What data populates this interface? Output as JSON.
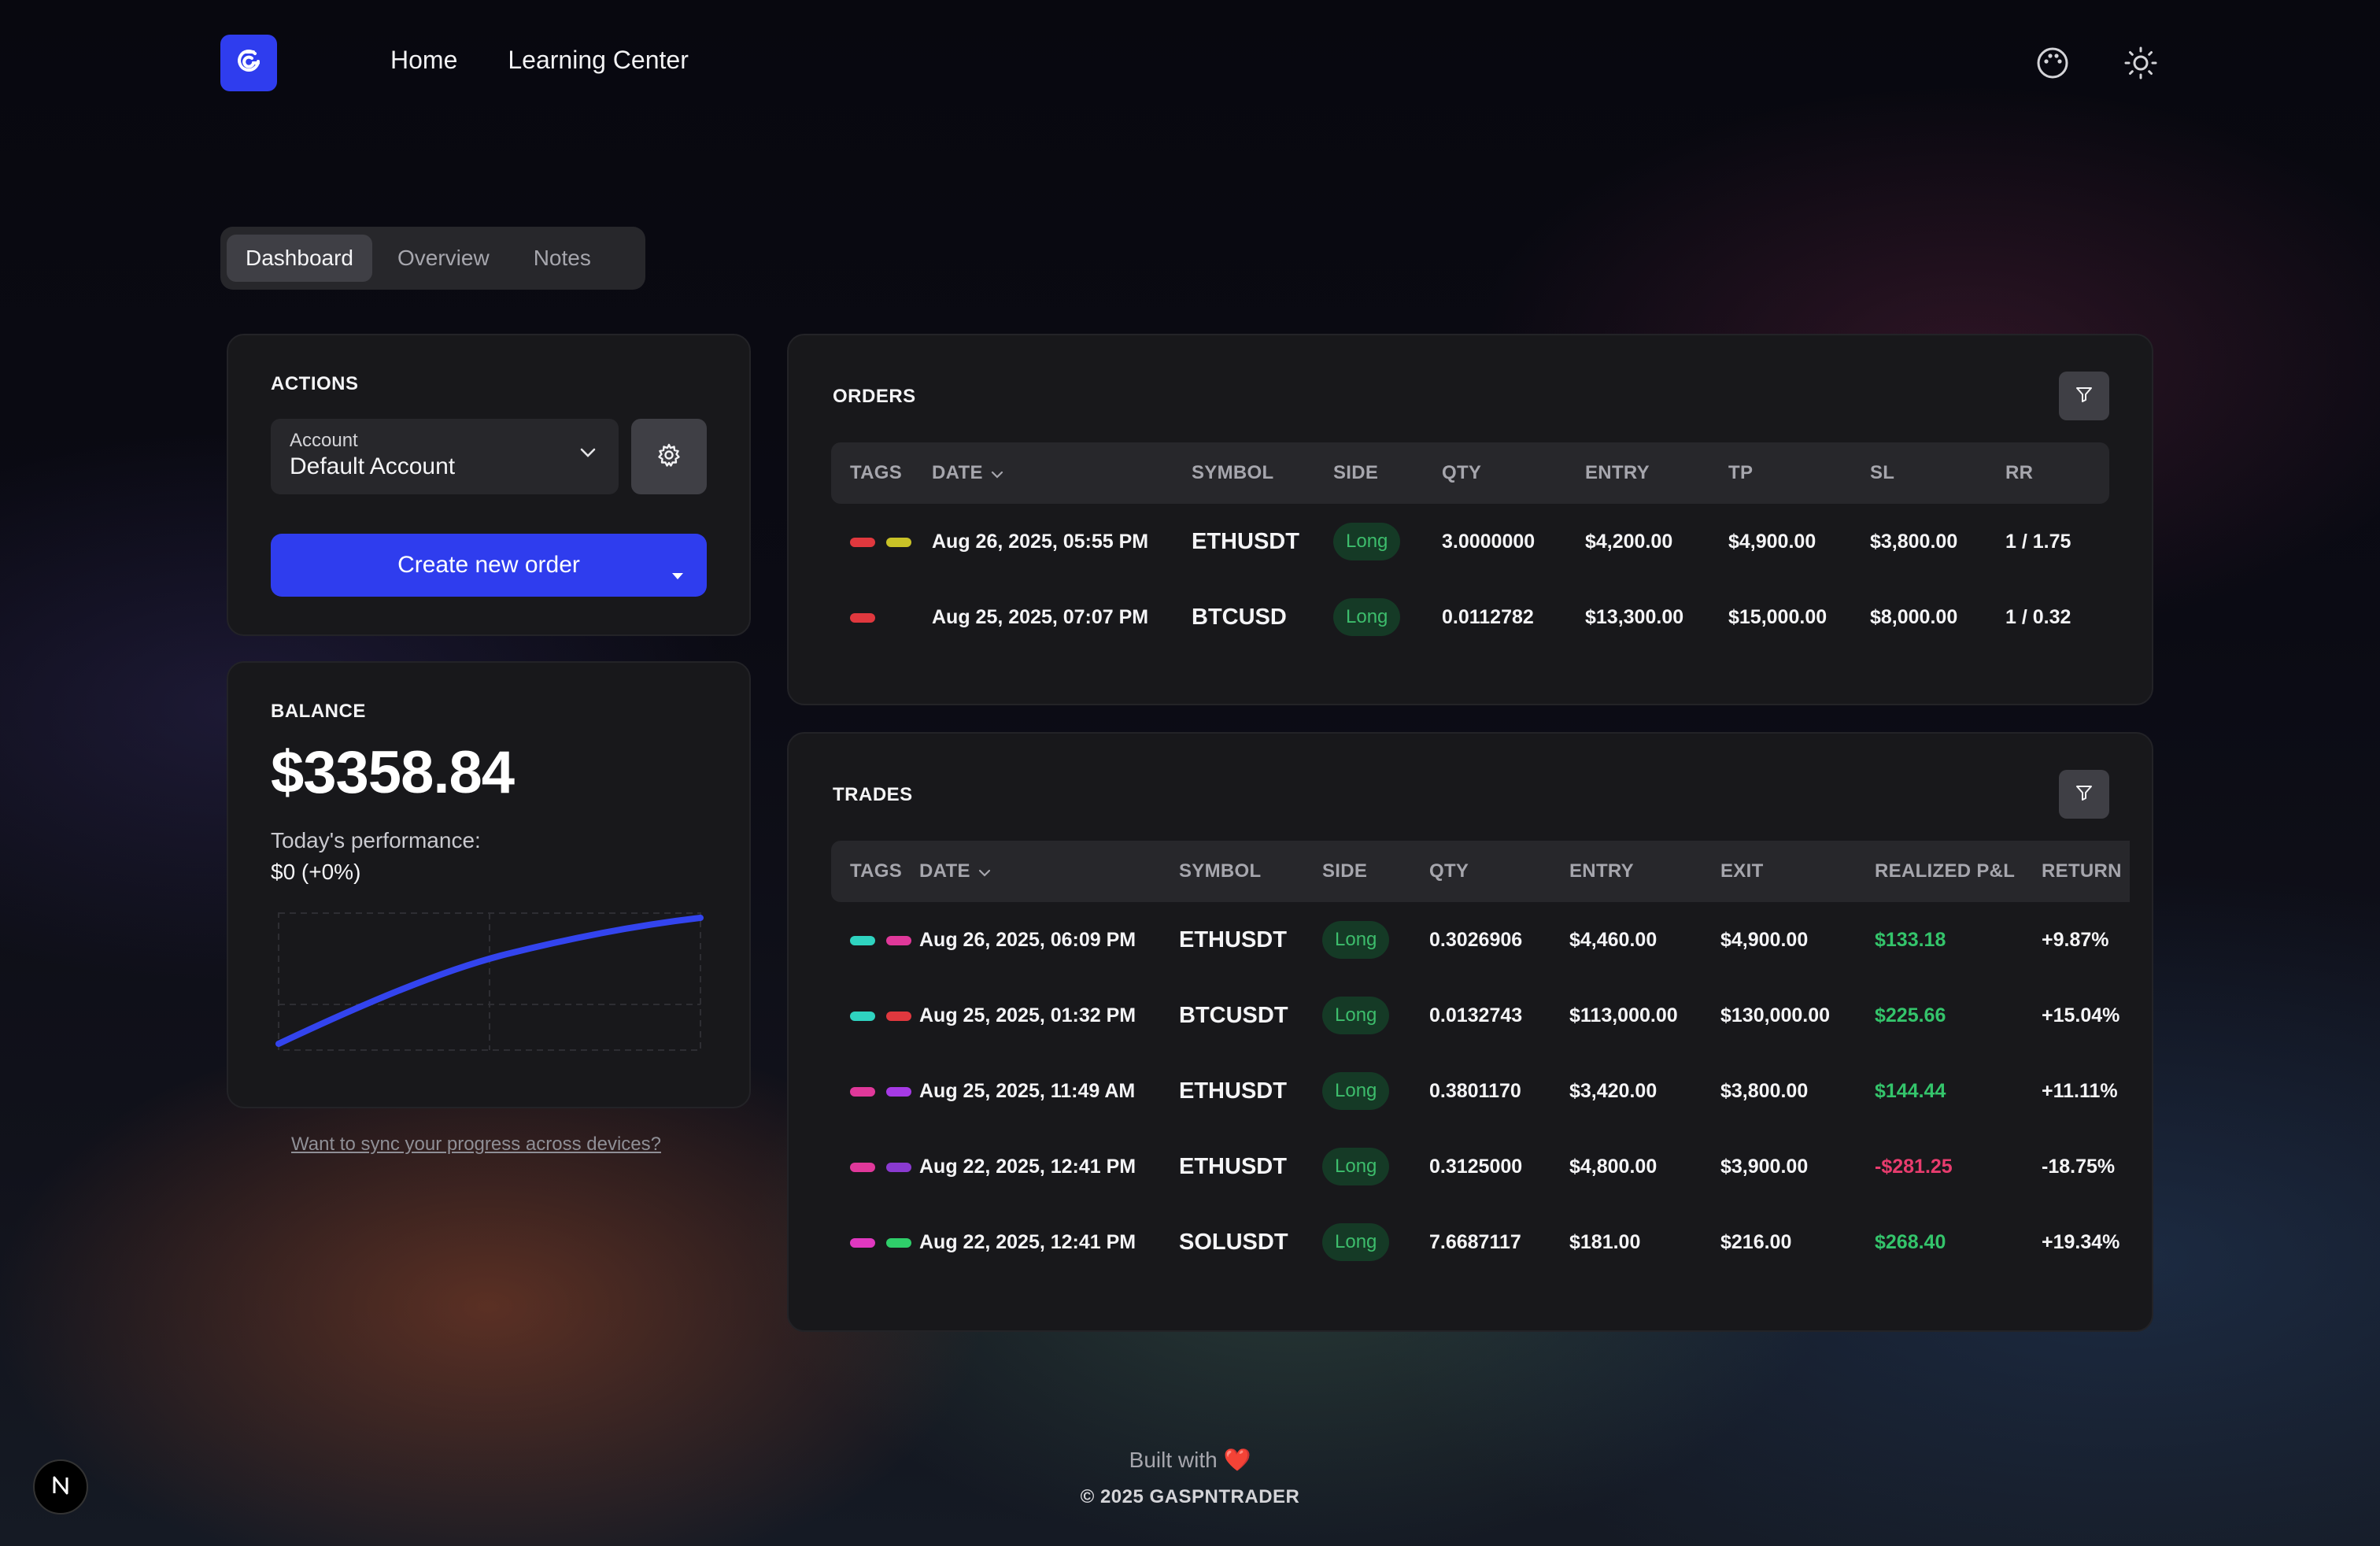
{
  "header": {
    "logo_icon": "swirl-logo-icon",
    "nav": [
      {
        "label": "Home"
      },
      {
        "label": "Learning Center"
      }
    ],
    "icons": [
      "palette-icon",
      "sun-icon"
    ]
  },
  "tabs": [
    {
      "label": "Dashboard",
      "active": true
    },
    {
      "label": "Overview",
      "active": false
    },
    {
      "label": "Notes",
      "active": false
    }
  ],
  "actions": {
    "title": "ACTIONS",
    "account_label": "Account",
    "account_value": "Default Account",
    "create_label": "Create new order"
  },
  "balance": {
    "title": "BALANCE",
    "amount": "$3358.84",
    "perf_label": "Today's performance:",
    "perf_value": "$0 (+0%)",
    "sparkline_trend": "rising"
  },
  "sync_link": "Want to sync your progress across devices?",
  "orders": {
    "title": "ORDERS",
    "columns": [
      "TAGS",
      "DATE",
      "SYMBOL",
      "SIDE",
      "QTY",
      "ENTRY",
      "TP",
      "SL",
      "RR"
    ],
    "rows": [
      {
        "tags": [
          "#e0383e",
          "#c9c227"
        ],
        "date": "Aug 26, 2025, 05:55 PM",
        "symbol": "ETHUSDT",
        "side": "Long",
        "qty": "3.0000000",
        "entry": "$4,200.00",
        "tp": "$4,900.00",
        "sl": "$3,800.00",
        "rr": "1 / 1.75"
      },
      {
        "tags": [
          "#e0383e"
        ],
        "date": "Aug 25, 2025, 07:07 PM",
        "symbol": "BTCUSD",
        "side": "Long",
        "qty": "0.0112782",
        "entry": "$13,300.00",
        "tp": "$15,000.00",
        "sl": "$8,000.00",
        "rr": "1 / 0.32"
      }
    ]
  },
  "trades": {
    "title": "TRADES",
    "columns": [
      "TAGS",
      "DATE",
      "SYMBOL",
      "SIDE",
      "QTY",
      "ENTRY",
      "EXIT",
      "REALIZED P&L",
      "RETURN"
    ],
    "rows": [
      {
        "tags": [
          "#2fd3c0",
          "#e0389a"
        ],
        "date": "Aug 26, 2025, 06:09 PM",
        "symbol": "ETHUSDT",
        "side": "Long",
        "qty": "0.3026906",
        "entry": "$4,460.00",
        "exit": "$4,900.00",
        "pnl": "$133.18",
        "pnl_sign": "pos",
        "ret": "+9.87%"
      },
      {
        "tags": [
          "#2fd3c0",
          "#e0383e"
        ],
        "date": "Aug 25, 2025, 01:32 PM",
        "symbol": "BTCUSDT",
        "side": "Long",
        "qty": "0.0132743",
        "entry": "$113,000.00",
        "exit": "$130,000.00",
        "pnl": "$225.66",
        "pnl_sign": "pos",
        "ret": "+15.04%"
      },
      {
        "tags": [
          "#e0389a",
          "#a63ae6"
        ],
        "date": "Aug 25, 2025, 11:49 AM",
        "symbol": "ETHUSDT",
        "side": "Long",
        "qty": "0.3801170",
        "entry": "$3,420.00",
        "exit": "$3,800.00",
        "pnl": "$144.44",
        "pnl_sign": "pos",
        "ret": "+11.11%"
      },
      {
        "tags": [
          "#e0389a",
          "#8a3ad0"
        ],
        "date": "Aug 22, 2025, 12:41 PM",
        "symbol": "ETHUSDT",
        "side": "Long",
        "qty": "0.3125000",
        "entry": "$4,800.00",
        "exit": "$3,900.00",
        "pnl": "-$281.25",
        "pnl_sign": "neg",
        "ret": "-18.75%"
      },
      {
        "tags": [
          "#e038c0",
          "#2fce6a"
        ],
        "date": "Aug 22, 2025, 12:41 PM",
        "symbol": "SOLUSDT",
        "side": "Long",
        "qty": "7.6687117",
        "entry": "$181.00",
        "exit": "$216.00",
        "pnl": "$268.40",
        "pnl_sign": "pos",
        "ret": "+19.34%"
      }
    ]
  },
  "footer": {
    "built_with": "Built with",
    "heart": "❤️",
    "copyright": "© 2025 GASPNTRADER"
  },
  "colors": {
    "accent": "#2f3dee",
    "card": "#18181b",
    "positive": "#34c46b",
    "negative": "#e83c6e",
    "long_badge_bg": "#153a26"
  }
}
